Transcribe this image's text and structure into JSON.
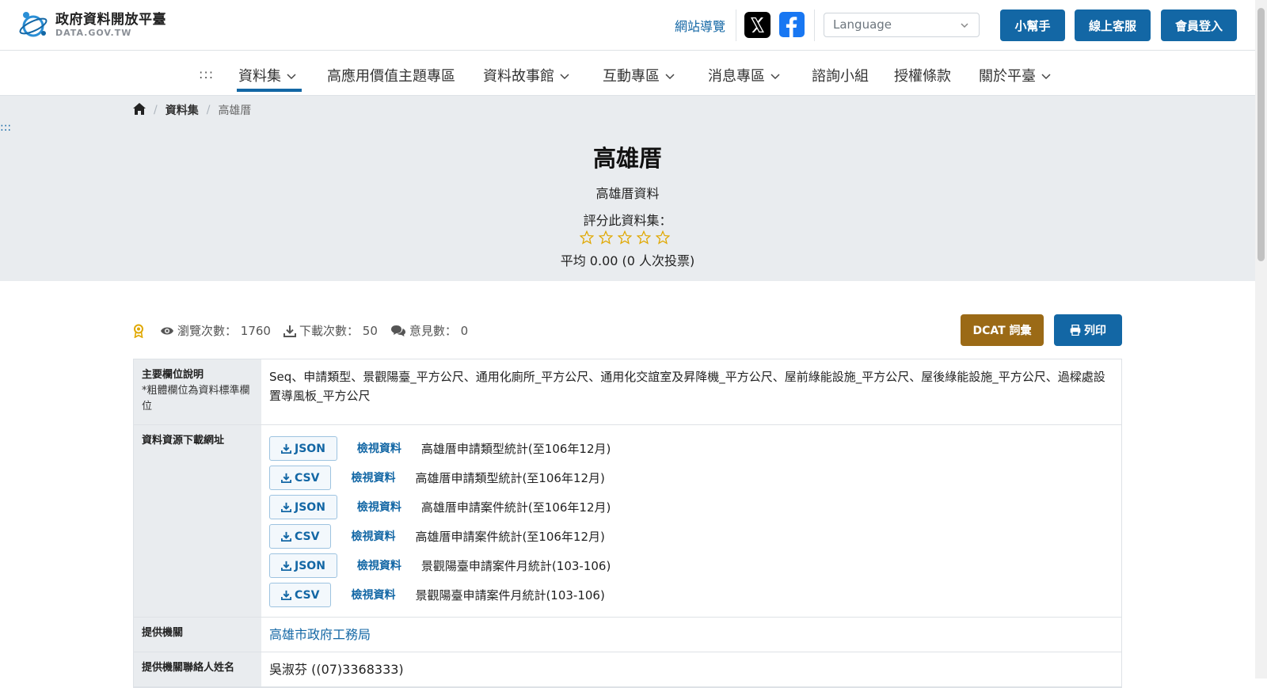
{
  "header": {
    "logo_zh": "政府資料開放平臺",
    "logo_en": "DATA.GOV.TW",
    "sitemap_label": "網站導覽",
    "language_placeholder": "Language",
    "helper_label": "小幫手",
    "support_label": "線上客服",
    "login_label": "會員登入"
  },
  "nav": {
    "dots": ":::",
    "items": [
      "資料集",
      "高應用價值主題專區",
      "資料故事館",
      "互動專區",
      "消息專區",
      "諮詢小組",
      "授權條款",
      "關於平臺"
    ]
  },
  "breadcrumb": {
    "datasets": "資料集",
    "current": "高雄厝"
  },
  "hero": {
    "dots": ":::",
    "title": "高雄厝",
    "description": "高雄厝資料",
    "rate_prompt": "評分此資料集：",
    "rating_stars": 0,
    "average": "平均 0.00 (0 人次投票)"
  },
  "stats": {
    "views_label": "瀏覽次數：",
    "views": "1760",
    "downloads_label": "下載次數：",
    "downloads": "50",
    "comments_label": "意見數：",
    "comments": "0"
  },
  "actions": {
    "dcat_label": "DCAT 詞彙",
    "print_label": "列印"
  },
  "table": {
    "fields_header": "主要欄位說明",
    "fields_note": "*粗體欄位為資料標準欄位",
    "fields_value": "Seq、申請類型、景觀陽臺_平方公尺、通用化廁所_平方公尺、通用化交誼室及昇降機_平方公尺、屋前綠能設施_平方公尺、屋後綠能設施_平方公尺、過樑處設置導風板_平方公尺",
    "resources_header": "資料資源下載網址",
    "resources": [
      {
        "format": "JSON",
        "view": "檢視資料",
        "name": "高雄厝申請類型統計(至106年12月)"
      },
      {
        "format": "CSV",
        "view": "檢視資料",
        "name": "高雄厝申請類型統計(至106年12月)"
      },
      {
        "format": "JSON",
        "view": "檢視資料",
        "name": "高雄厝申請案件統計(至106年12月)"
      },
      {
        "format": "CSV",
        "view": "檢視資料",
        "name": "高雄厝申請案件統計(至106年12月)"
      },
      {
        "format": "JSON",
        "view": "檢視資料",
        "name": "景觀陽臺申請案件月統計(103-106)"
      },
      {
        "format": "CSV",
        "view": "檢視資料",
        "name": "景觀陽臺申請案件月統計(103-106)"
      }
    ],
    "provider_header": "提供機關",
    "provider": "高雄市政府工務局",
    "contact_header": "提供機關聯絡人姓名",
    "contact": "吳淑芬 ((07)3368333)"
  },
  "colors": {
    "primary": "#1367a5",
    "dcat": "#9b6a16",
    "hero_bg": "#e9ecef",
    "star": "#e0a800"
  }
}
